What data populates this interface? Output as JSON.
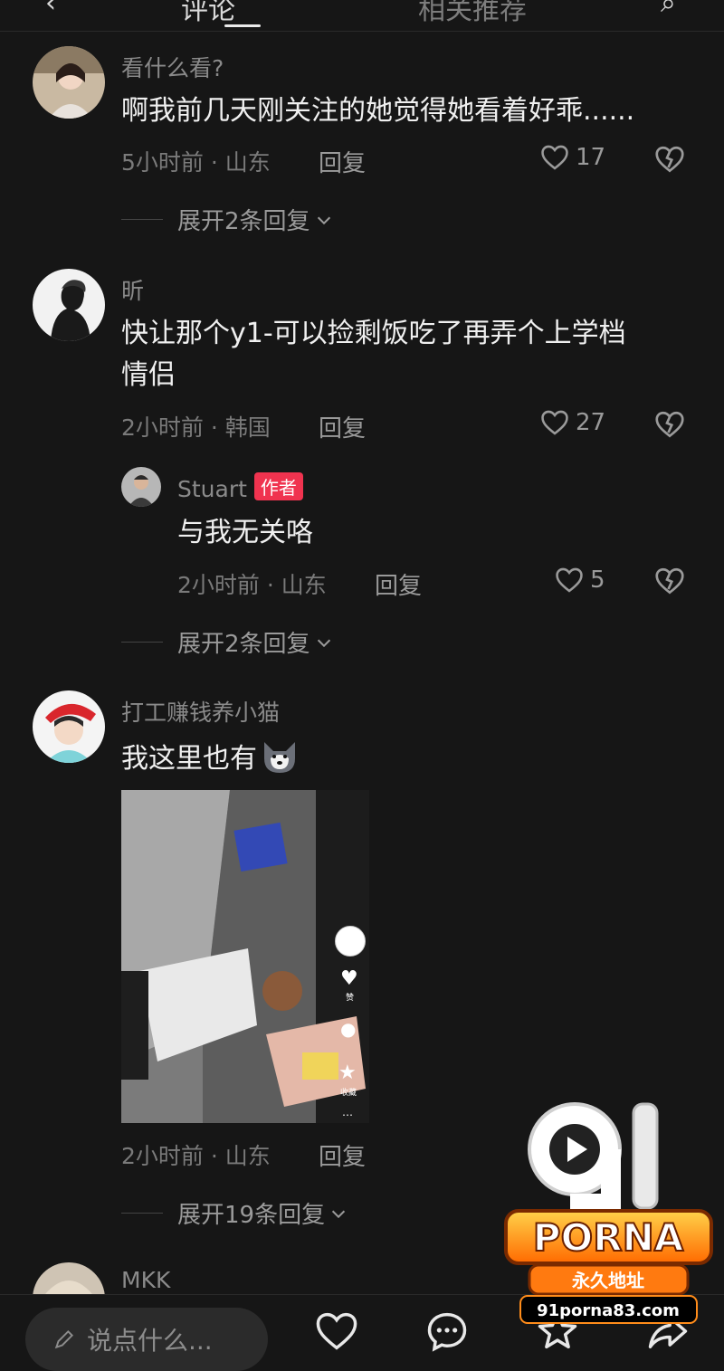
{
  "top_tabs": [
    {
      "label": "评论"
    },
    {
      "label": "相关推荐"
    }
  ],
  "comments": [
    {
      "username": "看什么看?",
      "text": "啊我前几天刚关注的她觉得她看着好乖......",
      "meta": "5小时前 · 山东",
      "reply_label": "回复",
      "likes": "17",
      "expand": "展开2条回复"
    },
    {
      "username": "昕",
      "text_line1": "快让那个y1-可以捡剩饭吃了再弄个上学档",
      "text_line2": "情侣",
      "meta": "2小时前 · 韩国",
      "reply_label": "回复",
      "likes": "27",
      "reply": {
        "username": "Stuart",
        "badge": "作者",
        "text": "与我无关咯",
        "meta": "2小时前 · 山东",
        "reply_label": "回复",
        "likes": "5"
      },
      "expand": "展开2条回复"
    },
    {
      "username": "打工赚钱养小猫",
      "text": "我这里也有",
      "meta": "2小时前 · 山东",
      "reply_label": "回复",
      "expand": "展开19条回复"
    },
    {
      "username": "MKK"
    }
  ],
  "thumbnail_overlay": {
    "like_label": "赞",
    "fav_label": "收藏"
  },
  "bottom_bar": {
    "input_placeholder": "说点什么..."
  },
  "watermark": {
    "line1": "PORNA",
    "line2": "永久地址",
    "url": "91porna83.com"
  },
  "icons": {
    "like": "heart-outline-icon",
    "dislike": "broken-heart-icon",
    "comment": "chat-bubble-icon",
    "favorite": "star-icon",
    "share": "share-arrow-icon",
    "edit": "pencil-icon"
  },
  "colors": {
    "background": "#161616",
    "author_badge": "#f0334f",
    "watermark_orange": "#ff8c1a"
  }
}
